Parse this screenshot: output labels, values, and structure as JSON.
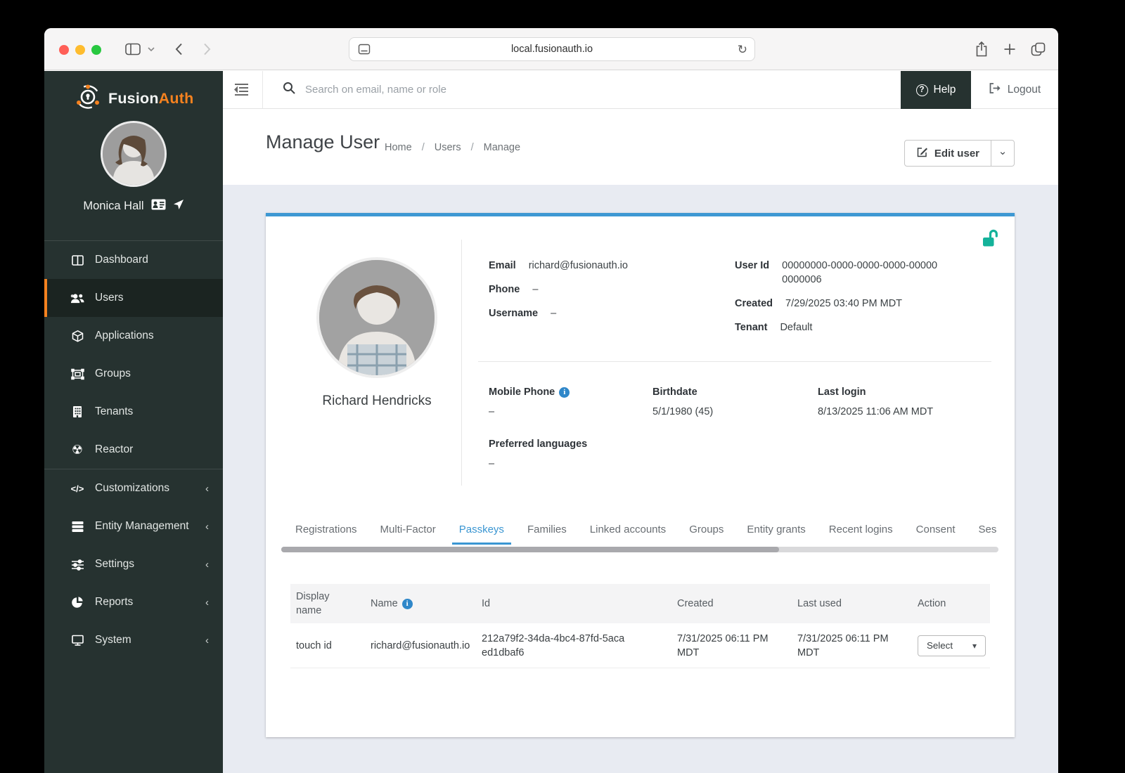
{
  "browser": {
    "url": "local.fusionauth.io"
  },
  "sidebar": {
    "logo": {
      "fusion": "Fusion",
      "auth": "Auth"
    },
    "user": {
      "name": "Monica Hall"
    },
    "items": [
      {
        "label": "Dashboard"
      },
      {
        "label": "Users"
      },
      {
        "label": "Applications"
      },
      {
        "label": "Groups"
      },
      {
        "label": "Tenants"
      },
      {
        "label": "Reactor"
      },
      {
        "label": "Customizations"
      },
      {
        "label": "Entity Management"
      },
      {
        "label": "Settings"
      },
      {
        "label": "Reports"
      },
      {
        "label": "System"
      }
    ]
  },
  "topbar": {
    "search_placeholder": "Search on email, name or role",
    "help_label": "Help",
    "logout_label": "Logout"
  },
  "page": {
    "title": "Manage User",
    "breadcrumb": [
      "Home",
      "Users",
      "Manage"
    ],
    "edit_button": "Edit user"
  },
  "user_card": {
    "name": "Richard Hendricks",
    "email_label": "Email",
    "email": "richard@fusionauth.io",
    "phone_label": "Phone",
    "phone": "–",
    "username_label": "Username",
    "username": "–",
    "user_id_label": "User Id",
    "user_id": "00000000-0000-0000-0000-000000000006",
    "created_label": "Created",
    "created": "7/29/2025 03:40 PM MDT",
    "tenant_label": "Tenant",
    "tenant": "Default",
    "mobile_label": "Mobile Phone",
    "mobile": "–",
    "birthdate_label": "Birthdate",
    "birthdate": "5/1/1980 (45)",
    "last_login_label": "Last login",
    "last_login": "8/13/2025 11:06 AM MDT",
    "languages_label": "Preferred languages",
    "languages": "–"
  },
  "tabs": [
    "Registrations",
    "Multi-Factor",
    "Passkeys",
    "Families",
    "Linked accounts",
    "Groups",
    "Entity grants",
    "Recent logins",
    "Consent",
    "Ses"
  ],
  "active_tab": "Passkeys",
  "passkeys_table": {
    "headers": {
      "display_name": "Display name",
      "name": "Name",
      "id": "Id",
      "created": "Created",
      "last_used": "Last used",
      "action": "Action"
    },
    "rows": [
      {
        "display_name": "touch id",
        "name": "richard@fusionauth.io",
        "id": "212a79f2-34da-4bc4-87fd-5acaed1dbaf6",
        "created": "7/31/2025 06:11 PM MDT",
        "last_used": "7/31/2025 06:11 PM MDT",
        "action": "Select"
      }
    ]
  },
  "colors": {
    "accent_orange": "#f5821f",
    "sidebar_bg": "#263230",
    "tab_active_blue": "#3a96d2",
    "card_top_border": "#3e98d3",
    "lock_teal": "#14b29a",
    "info_blue": "#2f87c9",
    "content_bg": "#e8ebf2"
  }
}
